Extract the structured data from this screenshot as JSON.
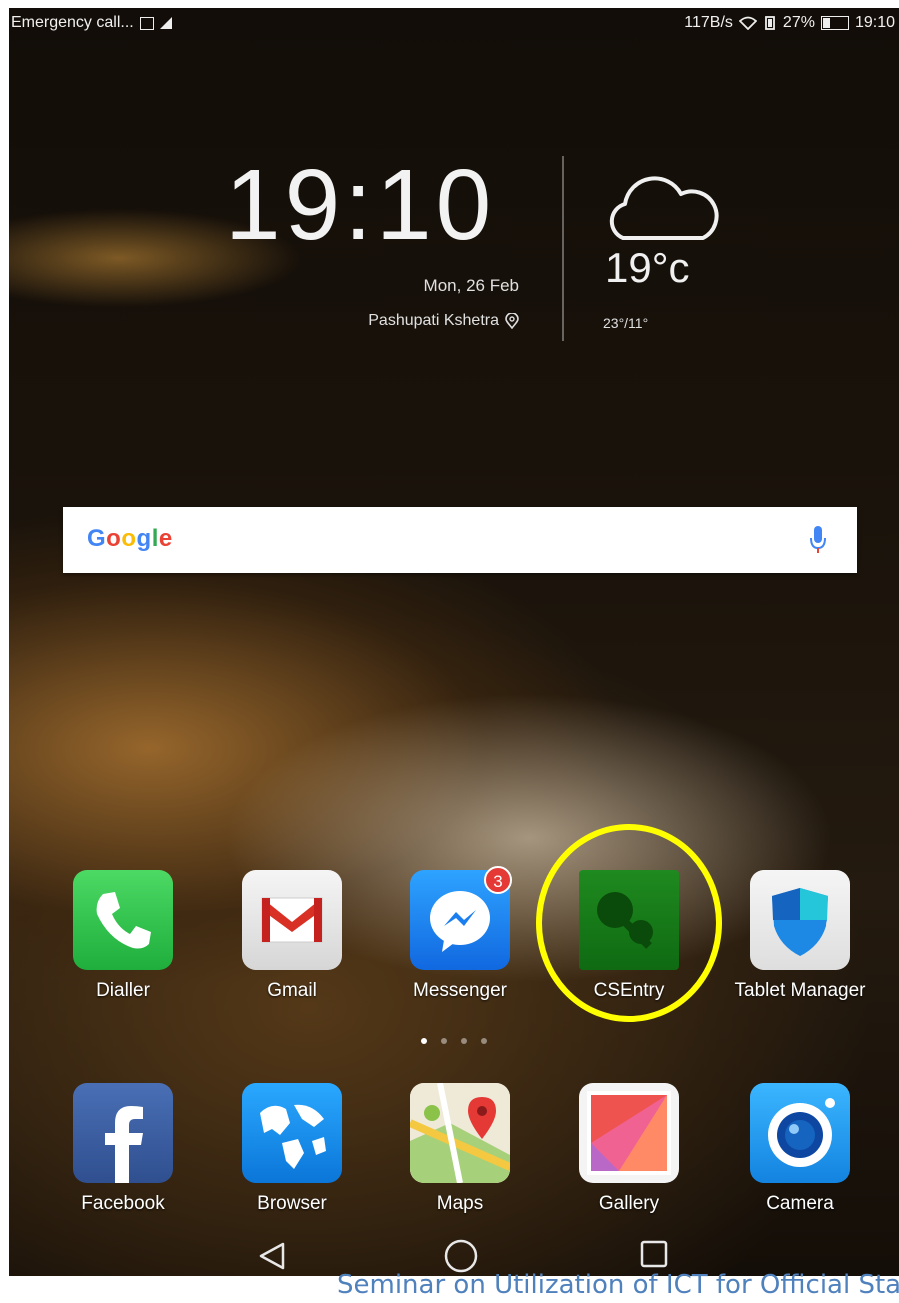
{
  "status_bar": {
    "left_text": "Emergency call...",
    "sim_icon": "sim-card-icon",
    "signal_icon": "signal-icon",
    "speed": "117B/s",
    "battery": "27%",
    "time": "19:10"
  },
  "widget": {
    "clock": "19:10",
    "date": "Mon, 26 Feb",
    "location": "Pashupati Kshetra",
    "temperature": "19°c",
    "temp_range": "23°/11°",
    "weather_icon": "cloud-icon"
  },
  "search": {
    "logo_letters": [
      {
        "ch": "G",
        "color": "#4285F4"
      },
      {
        "ch": "o",
        "color": "#EA4335"
      },
      {
        "ch": "o",
        "color": "#FBBC05"
      },
      {
        "ch": "g",
        "color": "#4285F4"
      },
      {
        "ch": "l",
        "color": "#34A853"
      },
      {
        "ch": "e",
        "color": "#EA4335"
      }
    ],
    "mic_icon": "microphone-icon"
  },
  "apps_row1": [
    {
      "label": "Dialler",
      "icon": "phone-icon"
    },
    {
      "label": "Gmail",
      "icon": "gmail-icon"
    },
    {
      "label": "Messenger",
      "icon": "messenger-icon",
      "badge": "3"
    },
    {
      "label": "CSEntry",
      "icon": "csentry-icon"
    },
    {
      "label": "Tablet Manager",
      "icon": "shield-icon"
    }
  ],
  "apps_row2": [
    {
      "label": "Facebook",
      "icon": "facebook-icon"
    },
    {
      "label": "Browser",
      "icon": "globe-icon"
    },
    {
      "label": "Maps",
      "icon": "maps-icon"
    },
    {
      "label": "Gallery",
      "icon": "gallery-icon"
    },
    {
      "label": "Camera",
      "icon": "camera-icon"
    }
  ],
  "page_indicator": {
    "total": 4,
    "active": 1
  },
  "highlight_color": "#FFFF00",
  "nav": {
    "back_icon": "back-triangle-icon",
    "home_icon": "home-circle-icon",
    "recent_icon": "recent-square-icon"
  },
  "caption": "Seminar on Utilization of ICT for Official Stat"
}
